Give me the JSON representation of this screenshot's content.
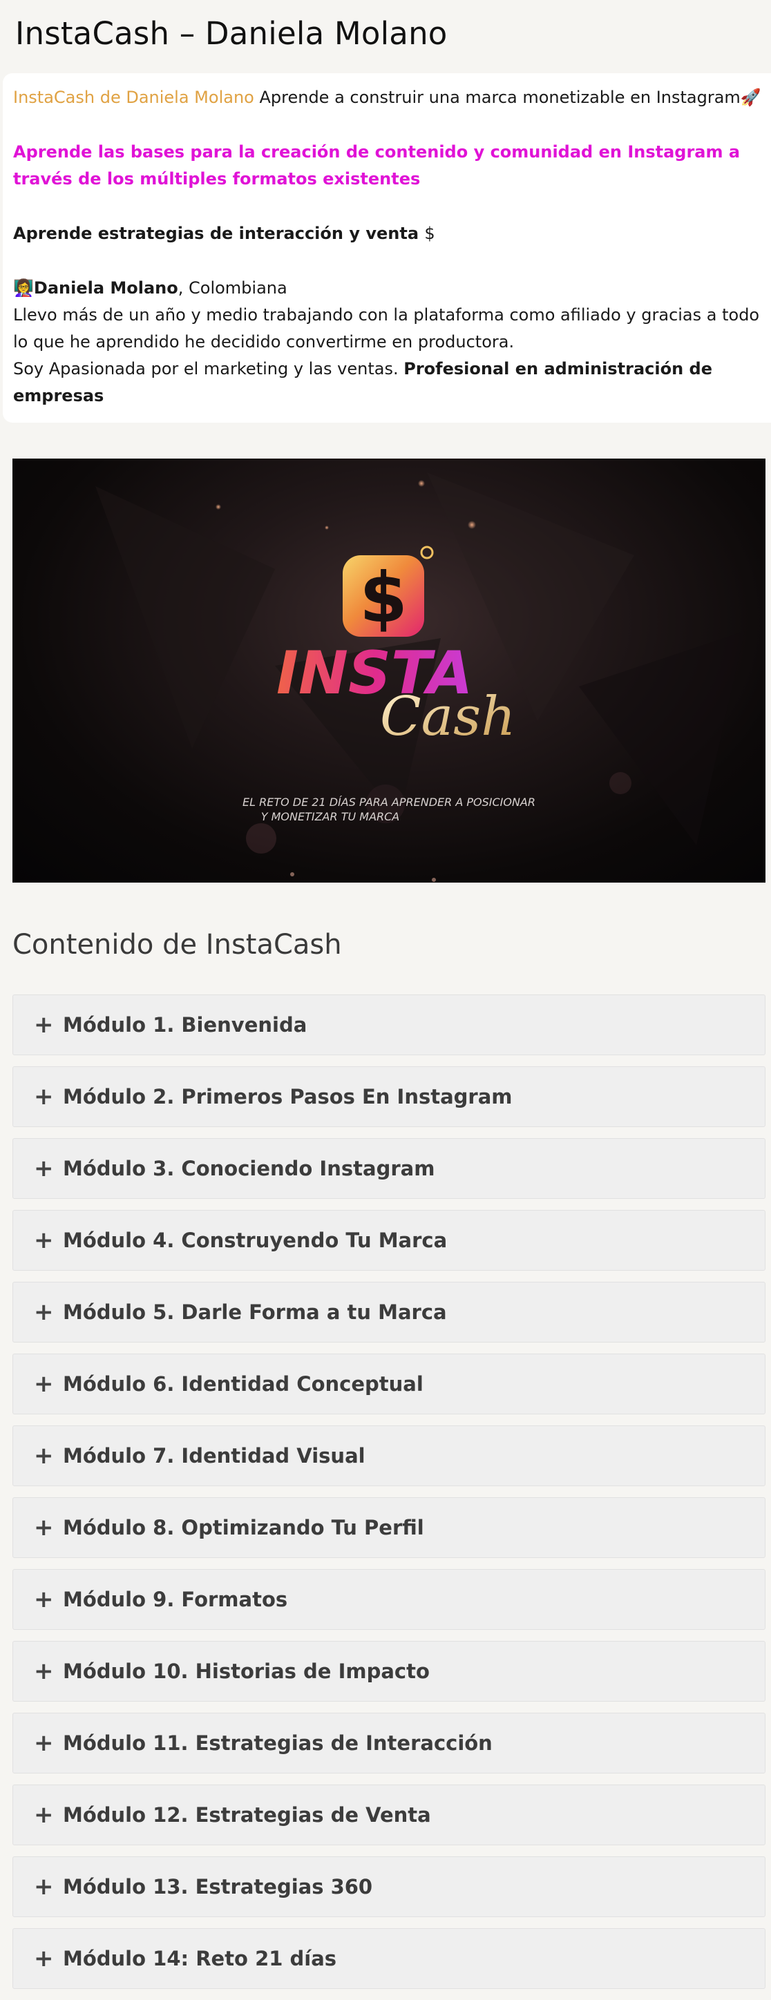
{
  "page": {
    "title": "InstaCash – Daniela Molano"
  },
  "intro": {
    "course_link": "InstaCash de Daniela Molano",
    "tagline": " Aprende a construir una marca monetizable en Instagram",
    "rocket": "🚀",
    "highlight": "Aprende las bases para la creación de contenido y comunidad en Instagram a través de los múltiples formatos existentes",
    "strategies": "Aprende estrategias de interacción y venta ",
    "dollar": "$",
    "author_emoji": "👩‍🏫",
    "author_name": "Daniela Molano",
    "author_origin": ", Colombiana",
    "bio1": "Llevo más de un año y medio trabajando con la plataforma como afiliado y gracias a todo lo que he aprendido he decidido convertirme en productora.",
    "bio2": "Soy Apasionada por el marketing y las ventas. ",
    "bio2_bold": "Profesional en administración de empresas"
  },
  "hero": {
    "logo_word1": "INSTA",
    "logo_word2": "Cash",
    "logo_symbol": "$",
    "caption_line1": "EL RETO DE 21 DÍAS PARA APRENDER A POSICIONAR",
    "caption_line2": "Y MONETIZAR TU MARCA"
  },
  "content": {
    "title": "Contenido de InstaCash",
    "toggle_icon": "+",
    "modules": [
      "Módulo 1. Bienvenida",
      "Módulo 2. Primeros Pasos En Instagram",
      "Módulo 3. Conociendo Instagram",
      "Módulo 4. Construyendo Tu Marca",
      "Módulo 5. Darle Forma a tu Marca",
      "Módulo 6. Identidad Conceptual",
      "Módulo 7. Identidad Visual",
      "Módulo 8. Optimizando Tu Perfil",
      "Módulo 9. Formatos",
      "Módulo 10. Historias de Impacto",
      "Módulo 11. Estrategias de Interacción",
      "Módulo 12. Estrategias de Venta",
      "Módulo 13. Estrategias 360",
      "Módulo 14: Reto 21 días"
    ]
  },
  "colors": {
    "accent_orange": "#e0a243",
    "accent_magenta": "#e012d6",
    "page_bg": "#f6f5f2",
    "module_bg": "#efefef"
  }
}
